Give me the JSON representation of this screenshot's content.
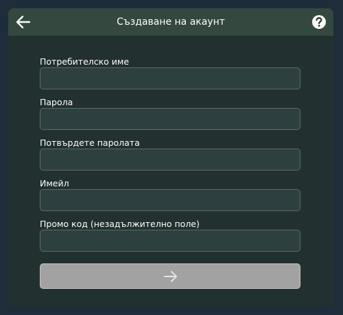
{
  "header": {
    "title": "Създаване на акаунт",
    "back_icon": "arrow-left-icon",
    "help_icon": "question-circle-icon"
  },
  "form": {
    "fields": [
      {
        "label": "Потребителско име",
        "value": "",
        "type": "text"
      },
      {
        "label": "Парола",
        "value": "",
        "type": "password"
      },
      {
        "label": "Потвърдете паролата",
        "value": "",
        "type": "password"
      },
      {
        "label": "Имейл",
        "value": "",
        "type": "email"
      },
      {
        "label": "Промо код (незадължително поле)",
        "value": "",
        "type": "text"
      }
    ],
    "submit_icon": "arrow-right-icon"
  },
  "colors": {
    "background": "#1f2d3a",
    "panel": "#233030",
    "header": "#34483f",
    "input_bg": "#2e3f3f",
    "input_border": "#5b6b68",
    "submit_bg": "#a2a2a2"
  }
}
